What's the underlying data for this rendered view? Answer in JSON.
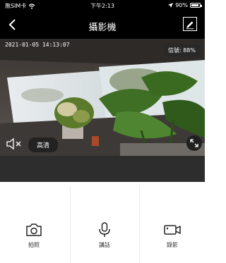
{
  "status_bar": {
    "carrier": "無SIM卡",
    "time": "下午2:13",
    "battery": "90%",
    "battery_level": 0.9
  },
  "nav": {
    "title": "攝影機",
    "back_icon": "chevron-left-icon",
    "edit_icon": "edit-icon"
  },
  "video": {
    "timestamp": "2021-01-05 14:13:07",
    "signal": "信號: 88%",
    "quality": "高清",
    "mute_icon": "speaker-muted-icon",
    "fullscreen_icon": "fullscreen-icon"
  },
  "controls": [
    {
      "label": "拍照",
      "icon": "camera-icon"
    },
    {
      "label": "講話",
      "icon": "microphone-icon"
    },
    {
      "label": "錄影",
      "icon": "video-camera-icon"
    }
  ]
}
